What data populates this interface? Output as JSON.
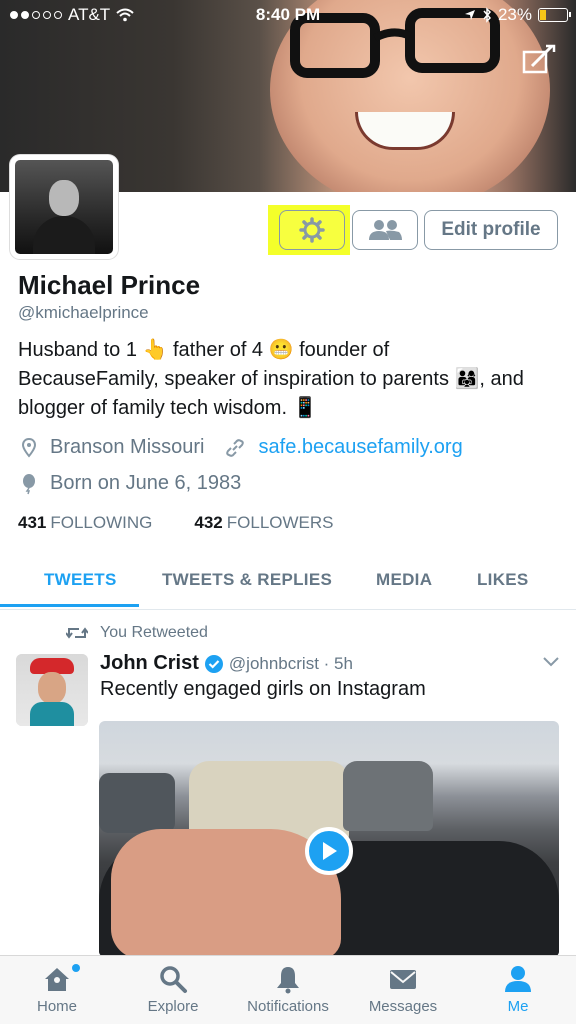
{
  "status_bar": {
    "carrier": "AT&T",
    "time": "8:40 PM",
    "battery": "23%",
    "battery_fraction": 0.23
  },
  "profile": {
    "name": "Michael Prince",
    "handle": "@kmichaelprince",
    "bio_line1": "Husband to 1 👆 father of 4 😬 founder of",
    "bio_line2": "BecauseFamily, speaker of inspiration to parents 👨‍👩‍👧, and",
    "bio_line3": "blogger of family tech wisdom. 📱",
    "location": "Branson Missouri",
    "website": "safe.becausefamily.org",
    "birthday": "Born on June 6, 1983",
    "following_count": "431",
    "following_label": "FOLLOWING",
    "followers_count": "432",
    "followers_label": "FOLLOWERS",
    "edit_label": "Edit profile"
  },
  "tabs": [
    "TWEETS",
    "TWEETS & REPLIES",
    "MEDIA",
    "LIKES"
  ],
  "tweet": {
    "retweet_note": "You Retweeted",
    "author": "John Crist",
    "handle_time": "@johnbcrist · 5h",
    "text": "Recently engaged girls on Instagram"
  },
  "tab_bar": {
    "home": "Home",
    "explore": "Explore",
    "notifications": "Notifications",
    "messages": "Messages",
    "me": "Me"
  },
  "colors": {
    "accent": "#1da1f2",
    "highlight": "#f4ff2a",
    "muted": "#657786"
  }
}
